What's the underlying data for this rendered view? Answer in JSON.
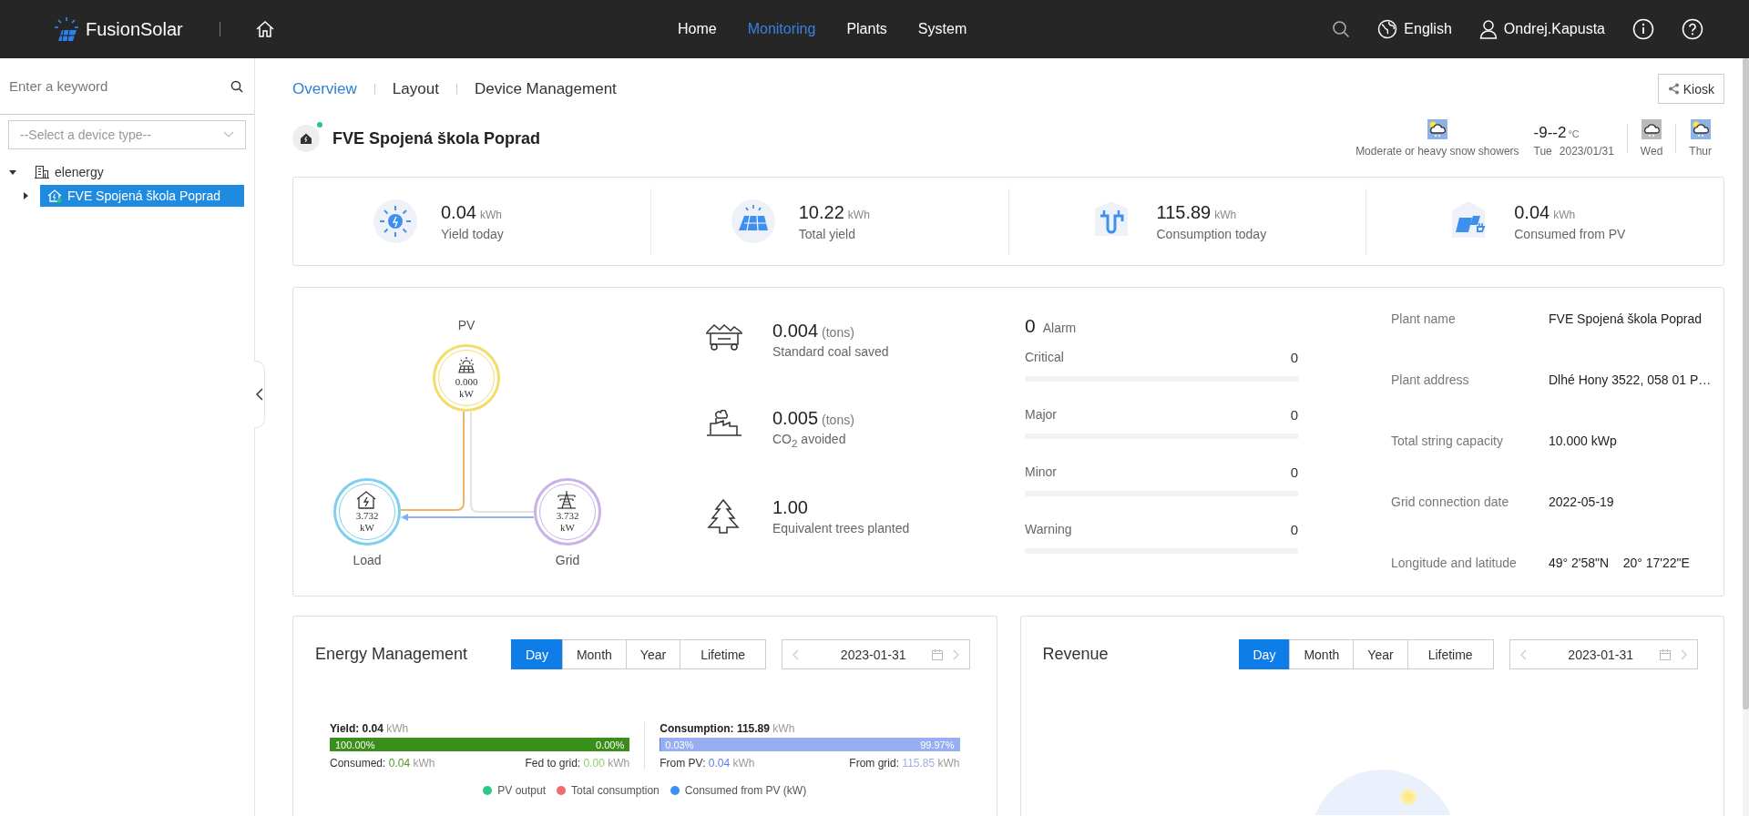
{
  "top_bar": {
    "brand": "FusionSolar",
    "nav": [
      {
        "label": "Home",
        "selected": false
      },
      {
        "label": "Monitoring",
        "selected": true
      },
      {
        "label": "Plants",
        "selected": false
      },
      {
        "label": "System",
        "selected": false
      }
    ],
    "language": "English",
    "user": "Ondrej.Kapusta"
  },
  "sidebar": {
    "search": {
      "placeholder": "Enter a keyword"
    },
    "device_type": {
      "placeholder": "--Select a device type--"
    },
    "tree": [
      {
        "label": "elenergy",
        "kind": "company",
        "expanded": true,
        "selected": false,
        "children": [
          {
            "label": "FVE Spojená škola Poprad",
            "kind": "plant",
            "expanded": false,
            "selected": true
          }
        ]
      }
    ]
  },
  "tabs": [
    {
      "label": "Overview",
      "selected": true
    },
    {
      "label": "Layout",
      "selected": false
    },
    {
      "label": "Device Management",
      "selected": false
    }
  ],
  "kiosk_button": "Kiosk",
  "plant": {
    "name": "FVE Spojená škola Poprad",
    "online": true
  },
  "weather": {
    "today": {
      "kind": "sun_cloud",
      "condition": "Moderate or heavy snow showers",
      "temperature": "-9--2",
      "unit": "°C",
      "day": "Tue",
      "date": "2023/01/31"
    },
    "forecast": [
      {
        "kind": "cloud",
        "day": "Wed"
      },
      {
        "kind": "sun_cloud",
        "day": "Thur"
      }
    ]
  },
  "kpis": [
    {
      "kind": "sun",
      "value": "0.04",
      "unit": "kWh",
      "label": "Yield today"
    },
    {
      "kind": "panel",
      "value": "10.22",
      "unit": "kWh",
      "label": "Total yield"
    },
    {
      "kind": "plug",
      "value": "115.89",
      "unit": "kWh",
      "label": "Consumption today"
    },
    {
      "kind": "house",
      "value": "0.04",
      "unit": "kWh",
      "label": "Consumed from PV"
    }
  ],
  "flow": {
    "nodes": [
      {
        "kind": "pv",
        "label": "PV",
        "value": "0.000",
        "unit": "kW"
      },
      {
        "kind": "load",
        "label": "Load",
        "value": "3.732",
        "unit": "kW"
      },
      {
        "kind": "grid",
        "label": "Grid",
        "value": "3.732",
        "unit": "kW"
      }
    ]
  },
  "environment": [
    {
      "kind": "coal",
      "value": "0.004",
      "unit": "(tons)",
      "label": "Standard coal saved"
    },
    {
      "kind": "co2",
      "value": "0.005",
      "unit": "(tons)",
      "label": "CO$_{2}$ avoided"
    },
    {
      "kind": "tree",
      "value": "1.00",
      "label": "Equivalent trees planted"
    }
  ],
  "alarms": {
    "total": "0",
    "label": "Alarm",
    "levels": [
      {
        "label": "Critical",
        "count": "0",
        "level": 0
      },
      {
        "label": "Major",
        "count": "0",
        "level": 0
      },
      {
        "label": "Minor",
        "count": "0",
        "level": 0
      },
      {
        "label": "Warning",
        "count": "0",
        "level": 0
      }
    ]
  },
  "plant_info": [
    {
      "label": "Plant name",
      "value": "FVE Spojená škola Poprad"
    },
    {
      "label": "Plant address",
      "value": "Dlhé Hony 3522, 058 01 P…"
    },
    {
      "label": "Total string capacity",
      "value": "10.000 kWp"
    },
    {
      "label": "Grid connection date",
      "value": "2022-05-19"
    },
    {
      "label": "Longitude and latitude",
      "value": "49° 2'58\"N    20° 17'22\"E"
    }
  ],
  "energy_management": {
    "title": "Energy Management",
    "periods": [
      {
        "label": "Day",
        "selected": true
      },
      {
        "label": "Month",
        "selected": false
      },
      {
        "label": "Year",
        "selected": false
      },
      {
        "label": "Lifetime",
        "selected": false
      }
    ],
    "date": "2023-01-31",
    "bars": [
      {
        "kind": "yield",
        "label": "Yield:",
        "value": "0.04",
        "unit": "kWh",
        "level": 1,
        "left_pct": "100.00%",
        "right_pct": "0.00%",
        "left": {
          "label": "Consumed:",
          "value": "0.04",
          "unit": "kWh"
        },
        "right": {
          "label": "Fed to grid:",
          "value": "0.00",
          "unit": "kWh"
        }
      },
      {
        "kind": "consumption",
        "label": "Consumption:",
        "value": "115.89",
        "unit": "kWh",
        "level": 0.0003,
        "left_pct": "0.03%",
        "right_pct": "99.97%",
        "left": {
          "label": "From PV:",
          "value": "0.04",
          "unit": "kWh"
        },
        "right": {
          "label": "From grid:",
          "value": "115.85",
          "unit": "kWh"
        }
      }
    ],
    "legend": [
      {
        "label": "PV output",
        "color": "#2dc78a"
      },
      {
        "label": "Total consumption",
        "color": "#f16b6b"
      },
      {
        "label": "Consumed from PV (kW)",
        "color": "#3b8ff5"
      }
    ]
  },
  "revenue": {
    "title": "Revenue",
    "periods": [
      {
        "label": "Day",
        "selected": true
      },
      {
        "label": "Month",
        "selected": false
      },
      {
        "label": "Year",
        "selected": false
      },
      {
        "label": "Lifetime",
        "selected": false
      }
    ],
    "date": "2023-01-31"
  }
}
